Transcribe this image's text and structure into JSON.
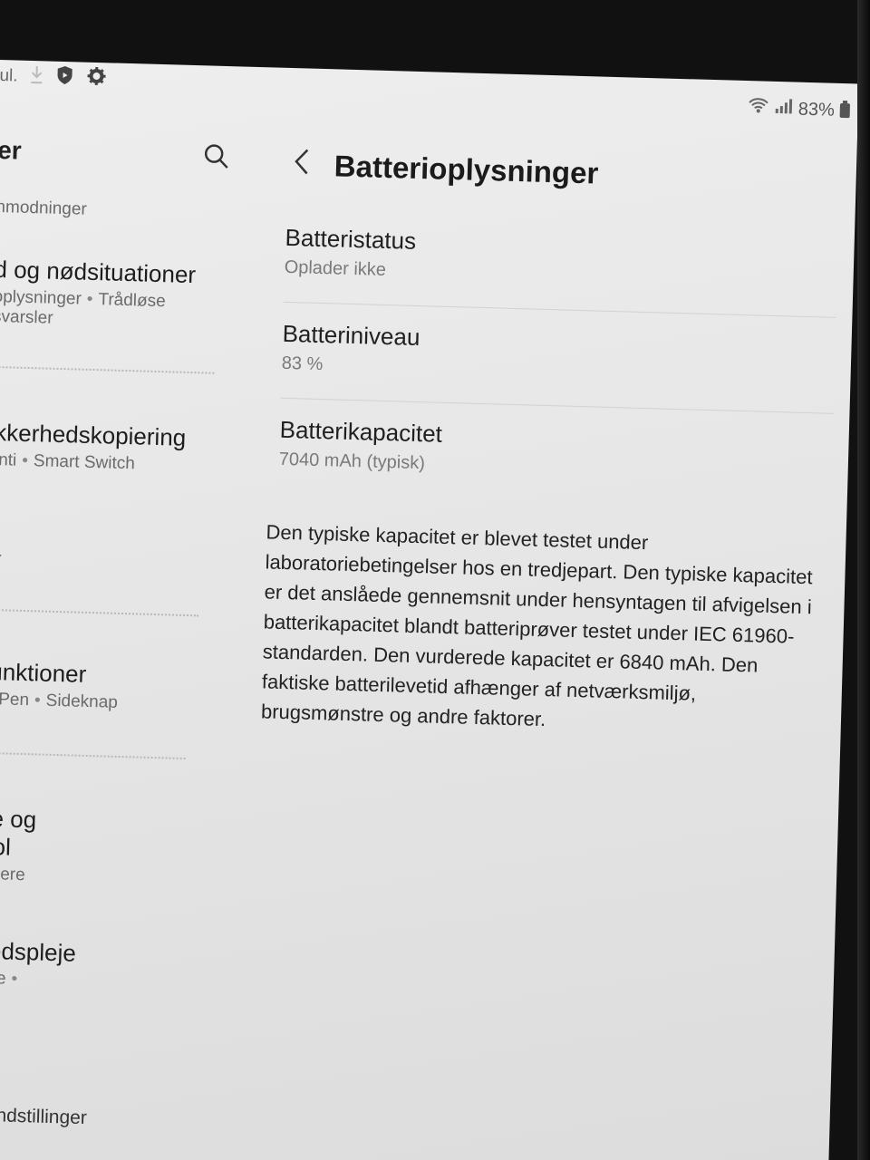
{
  "status_bar": {
    "left_network": "ul.",
    "battery_percent": "83%"
  },
  "left_pane": {
    "title": "er",
    "items": [
      {
        "title": "",
        "subtitle": "nmodninger"
      },
      {
        "title": "d og nødsituationer",
        "subtitle_parts": [
          "oplysninger",
          "Trådløse"
        ],
        "subtitle2": "svarsler"
      },
      {
        "title": "ikkerhedskopiering",
        "subtitle_parts": [
          "onti",
          "Smart Switch"
        ]
      },
      {
        "title": "",
        "subtitle": "er"
      },
      {
        "title": "funktioner",
        "subtitle_parts": [
          "S Pen",
          "Sideknap"
        ]
      },
      {
        "title_line1": "ce og",
        "title_line2": "trol",
        "subtitle": "timere"
      },
      {
        "title": "hedspleje",
        "subtitle": "else",
        "subtitle2": "e"
      },
      {
        "title": "ppindstillinger"
      }
    ],
    "separator": "•"
  },
  "right_pane": {
    "title": "Batterioplysninger",
    "items": [
      {
        "label": "Batteristatus",
        "value": "Oplader ikke"
      },
      {
        "label": "Batteriniveau",
        "value": "83 %"
      },
      {
        "label": "Batterikapacitet",
        "value": "7040 mAh (typisk)"
      }
    ],
    "description": "Den typiske kapacitet er blevet testet under laboratoriebetingelser hos en tredjepart. Den typiske kapacitet er det anslåede gennemsnit under hensyntagen til afvigelsen i batterikapacitet blandt batteriprøver testet under IEC 61960-standarden. Den vurderede kapacitet er 6840 mAh. Den faktiske batterilevetid afhænger af netværksmiljø, brugsmønstre og andre faktorer."
  },
  "icons": {
    "status_left": [
      "download-icon",
      "shield-icon",
      "gear-icon"
    ],
    "status_right": [
      "wifi-icon",
      "signal-icon",
      "battery-icon"
    ],
    "left_header": "search-icon",
    "right_header": "back-chevron-icon"
  }
}
